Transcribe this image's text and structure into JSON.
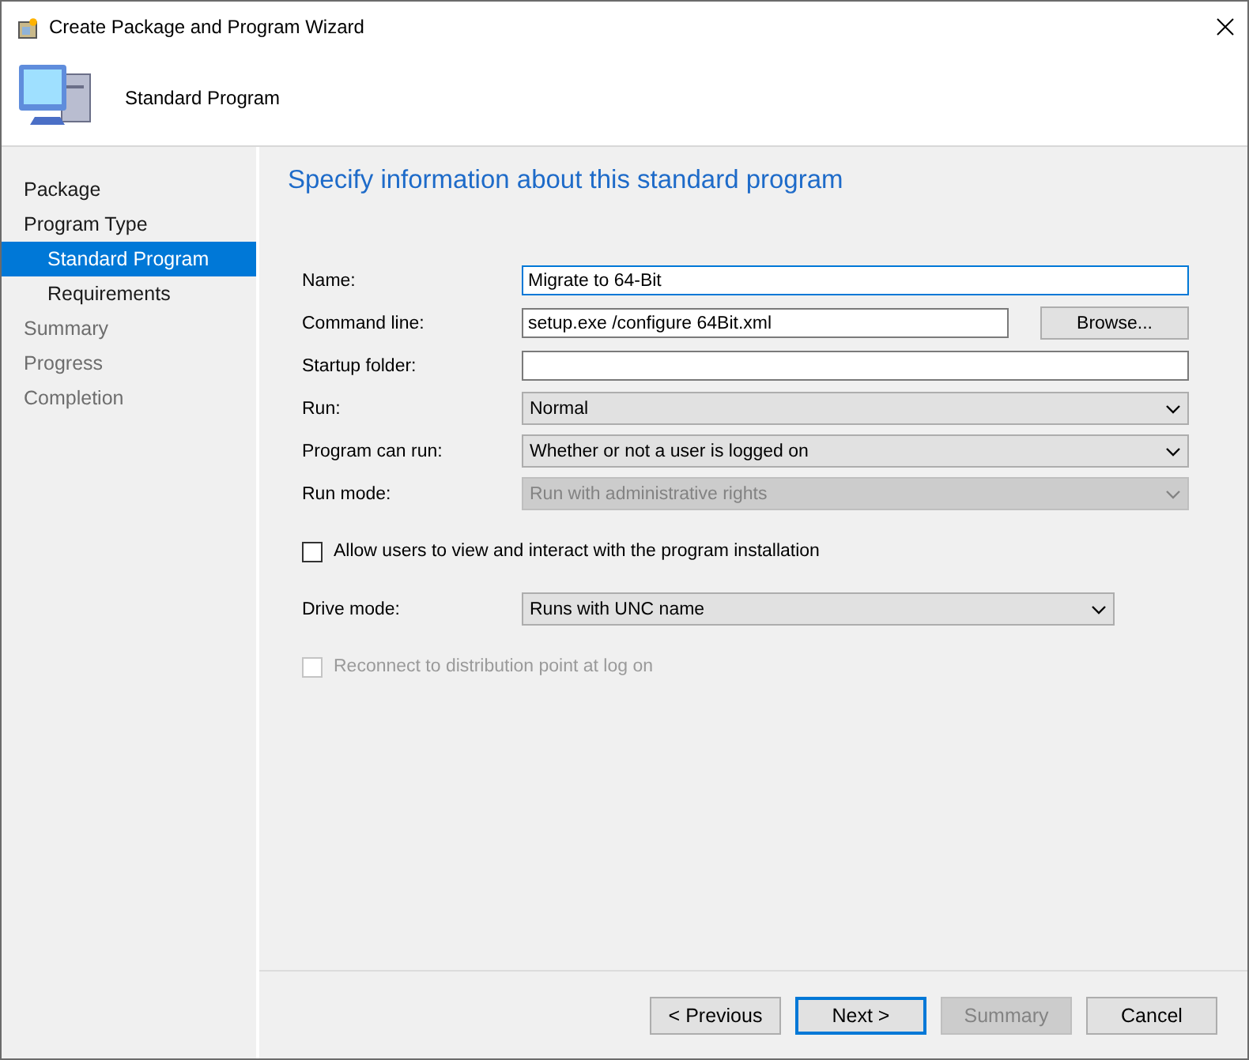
{
  "window": {
    "title": "Create Package and Program Wizard"
  },
  "header": {
    "title": "Standard Program"
  },
  "sidebar": {
    "items": [
      {
        "label": "Package",
        "selected": false,
        "disabled": false
      },
      {
        "label": "Program Type",
        "selected": false,
        "disabled": false,
        "children": [
          {
            "label": "Standard Program",
            "selected": true,
            "disabled": false
          },
          {
            "label": "Requirements",
            "selected": false,
            "disabled": false
          }
        ]
      },
      {
        "label": "Summary",
        "selected": false,
        "disabled": true
      },
      {
        "label": "Progress",
        "selected": false,
        "disabled": true
      },
      {
        "label": "Completion",
        "selected": false,
        "disabled": true
      }
    ]
  },
  "page": {
    "heading": "Specify information about this standard program",
    "fields": [
      {
        "kind": "text",
        "label": "Name:",
        "value": "Migrate to 64-Bit",
        "focused": true
      },
      {
        "kind": "text",
        "label": "Command line:",
        "value": "setup.exe /configure 64Bit.xml",
        "focused": false,
        "button": "Browse..."
      },
      {
        "kind": "text",
        "label": "Startup folder:",
        "focused": false
      },
      {
        "kind": "dropdown",
        "label": "Run:",
        "value": "Normal",
        "focused": false,
        "disabled": false
      },
      {
        "kind": "dropdown",
        "label": "Program can run:",
        "value": "Whether or not a user is logged on",
        "focused": false,
        "disabled": false
      },
      {
        "kind": "dropdown",
        "label": "Run mode:",
        "value": "Run with administrative rights",
        "focused": false,
        "disabled": true
      },
      {
        "kind": "checkbox",
        "label": "Allow users to view and interact with the program installation",
        "checked": false,
        "disabled": false
      },
      {
        "kind": "short-dropdown",
        "label": "Drive mode:",
        "value": "Runs with UNC name",
        "focused": false,
        "disabled": false
      },
      {
        "kind": "checkbox",
        "label": "Reconnect to distribution point at log on",
        "checked": false,
        "disabled": true
      }
    ]
  },
  "buttons": [
    {
      "label": "< Previous",
      "default": false,
      "disabled": false
    },
    {
      "label": "Next >",
      "default": true,
      "disabled": false
    },
    {
      "label": "Summary",
      "default": false,
      "disabled": true
    },
    {
      "label": "Cancel",
      "default": false,
      "disabled": false
    }
  ]
}
